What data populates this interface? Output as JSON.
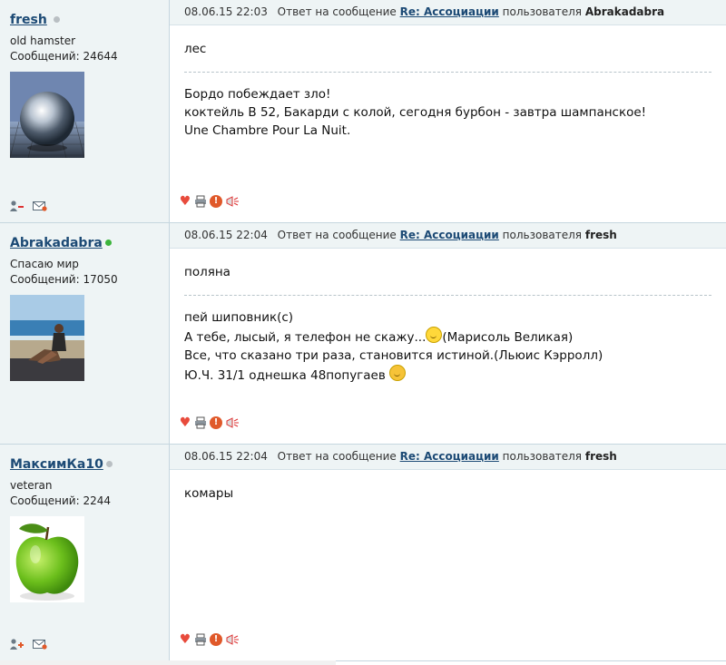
{
  "posts": [
    {
      "username": "fresh",
      "online": false,
      "title": "old hamster",
      "count": "Сообщений: 24644",
      "date": "08.06.15 22:03",
      "reply_prefix": "Ответ на сообщение",
      "thread": "Re: Ассоциации",
      "reply_mid": "пользователя",
      "reply_user": "Abrakadabra",
      "message": "лес",
      "signature": [
        "Бордо побеждает зло!",
        "коктейль В 52, Бакарди с колой, сегодня бурбон - завтра шампанское!",
        "Une Chambre Pour La Nuit."
      ]
    },
    {
      "username": "Abrakadabra",
      "online": true,
      "title": "Спасаю мир",
      "count": "Сообщений: 17050",
      "date": "08.06.15 22:04",
      "reply_prefix": "Ответ на сообщение",
      "thread": "Re: Ассоциации",
      "reply_mid": "пользователя",
      "reply_user": "fresh",
      "message": "поляна",
      "signature": [
        "пей шиповник(с)",
        "А тебе, лысый, я телефон не скажу...",
        "(Марисоль Великая)",
        "Все, что сказано три раза, становится истиной.(Льюис Кэрролл)",
        "Ю.Ч. 31/1 однешка 48попугаев"
      ]
    },
    {
      "username": "МаксимКа10",
      "online": false,
      "title": "veteran",
      "count": "Сообщений: 2244",
      "date": "08.06.15 22:04",
      "reply_prefix": "Ответ на сообщение",
      "thread": "Re: Ассоциации",
      "reply_mid": "пользователя",
      "reply_user": "fresh",
      "message": "комары"
    }
  ],
  "icons": {
    "profile": "user-profile-icon",
    "pm": "envelope-icon",
    "like": "heart-icon",
    "print": "printer-icon",
    "report": "warning-icon",
    "share": "megaphone-icon"
  },
  "colors": {
    "link": "#1c4a75",
    "sidebar_bg": "#eef4f5",
    "border": "#c5d6df",
    "online": "#3cb43c",
    "offline": "#b9bfc3"
  }
}
